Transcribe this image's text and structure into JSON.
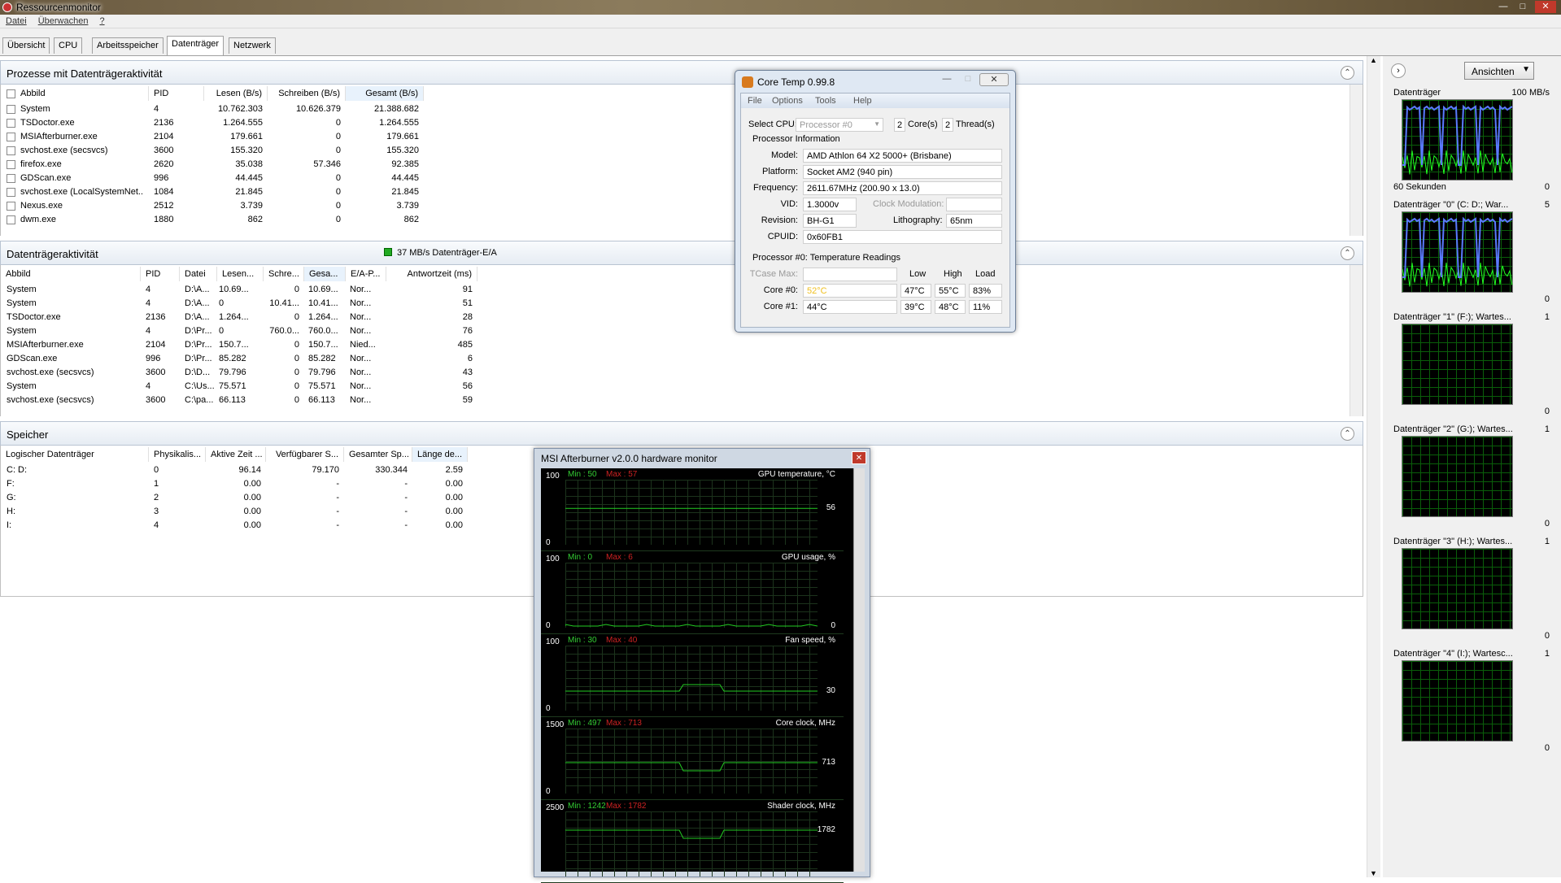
{
  "window": {
    "title": "Ressourcenmonitor"
  },
  "menu": [
    "Datei",
    "Überwachen",
    "?"
  ],
  "tabs": [
    "Übersicht",
    "CPU",
    "Arbeitsspeicher",
    "Datenträger",
    "Netzwerk"
  ],
  "proc": {
    "title": "Prozesse mit Datenträgeraktivität",
    "headers": [
      "Abbild",
      "PID",
      "Lesen (B/s)",
      "Schreiben (B/s)",
      "Gesamt (B/s)"
    ],
    "rows": [
      [
        "System",
        "4",
        "10.762.303",
        "10.626.379",
        "21.388.682"
      ],
      [
        "TSDoctor.exe",
        "2136",
        "1.264.555",
        "0",
        "1.264.555"
      ],
      [
        "MSIAfterburner.exe",
        "2104",
        "179.661",
        "0",
        "179.661"
      ],
      [
        "svchost.exe (secsvcs)",
        "3600",
        "155.320",
        "0",
        "155.320"
      ],
      [
        "firefox.exe",
        "2620",
        "35.038",
        "57.346",
        "92.385"
      ],
      [
        "GDScan.exe",
        "996",
        "44.445",
        "0",
        "44.445"
      ],
      [
        "svchost.exe (LocalSystemNet...",
        "1084",
        "21.845",
        "0",
        "21.845"
      ],
      [
        "Nexus.exe",
        "2512",
        "3.739",
        "0",
        "3.739"
      ],
      [
        "dwm.exe",
        "1880",
        "862",
        "0",
        "862"
      ]
    ]
  },
  "disk": {
    "title": "Datenträgeraktivität",
    "badge": "37 MB/s Datenträger-E/A",
    "headers": [
      "Abbild",
      "PID",
      "Datei",
      "Lesen...",
      "Schre...",
      "Gesa...",
      "E/A-P...",
      "Antwortzeit (ms)"
    ],
    "rows": [
      [
        "System",
        "4",
        "D:\\A...",
        "10.69...",
        "0",
        "10.69...",
        "Nor...",
        "91"
      ],
      [
        "System",
        "4",
        "D:\\A...",
        "0",
        "10.41...",
        "10.41...",
        "Nor...",
        "51"
      ],
      [
        "TSDoctor.exe",
        "2136",
        "D:\\A...",
        "1.264...",
        "0",
        "1.264...",
        "Nor...",
        "28"
      ],
      [
        "System",
        "4",
        "D:\\Pr...",
        "0",
        "760.0...",
        "760.0...",
        "Nor...",
        "76"
      ],
      [
        "MSIAfterburner.exe",
        "2104",
        "D:\\Pr...",
        "150.7...",
        "0",
        "150.7...",
        "Nied...",
        "485"
      ],
      [
        "GDScan.exe",
        "996",
        "D:\\Pr...",
        "85.282",
        "0",
        "85.282",
        "Nor...",
        "6"
      ],
      [
        "svchost.exe (secsvcs)",
        "3600",
        "D:\\D...",
        "79.796",
        "0",
        "79.796",
        "Nor...",
        "43"
      ],
      [
        "System",
        "4",
        "C:\\Us...",
        "75.571",
        "0",
        "75.571",
        "Nor...",
        "56"
      ],
      [
        "svchost.exe (secsvcs)",
        "3600",
        "C:\\pa...",
        "66.113",
        "0",
        "66.113",
        "Nor...",
        "59"
      ]
    ]
  },
  "storage": {
    "title": "Speicher",
    "headers": [
      "Logischer Datenträger",
      "Physikalis...",
      "Aktive Zeit ...",
      "Verfügbarer S...",
      "Gesamter Sp...",
      "Länge de..."
    ],
    "rows": [
      [
        "C: D:",
        "0",
        "96.14",
        "79.170",
        "330.344",
        "2.59"
      ],
      [
        "F:",
        "1",
        "0.00",
        "-",
        "-",
        "0.00"
      ],
      [
        "G:",
        "2",
        "0.00",
        "-",
        "-",
        "0.00"
      ],
      [
        "H:",
        "3",
        "0.00",
        "-",
        "-",
        "0.00"
      ],
      [
        "I:",
        "4",
        "0.00",
        "-",
        "-",
        "0.00"
      ]
    ]
  },
  "right": {
    "views_label": "Ansichten",
    "graphs": [
      {
        "label": "Datenträger",
        "top_value": "100 MB/s",
        "bottom_label": "60 Sekunden",
        "bottom_value": "0"
      },
      {
        "label": "Datenträger \"0\" (C: D:; War...",
        "top_value": "5",
        "bottom_value": "0"
      },
      {
        "label": "Datenträger \"1\" (F:); Wartes...",
        "top_value": "1",
        "bottom_value": "0"
      },
      {
        "label": "Datenträger \"2\" (G:); Wartes...",
        "top_value": "1",
        "bottom_value": "0"
      },
      {
        "label": "Datenträger \"3\" (H:); Wartes...",
        "top_value": "1",
        "bottom_value": "0"
      },
      {
        "label": "Datenträger \"4\" (I:); Wartesc...",
        "top_value": "1",
        "bottom_value": "0"
      }
    ]
  },
  "coretemp": {
    "title": "Core Temp 0.99.8",
    "menu": [
      "File",
      "Options",
      "Tools",
      "Help"
    ],
    "select_cpu_label": "Select CPU:",
    "processor": "Processor #0",
    "cores": "2",
    "cores_label": "Core(s)",
    "threads": "2",
    "threads_label": "Thread(s)",
    "info_title": "Processor Information",
    "model_label": "Model:",
    "model": "AMD Athlon 64 X2 5000+ (Brisbane)",
    "platform_label": "Platform:",
    "platform": "Socket AM2 (940 pin)",
    "freq_label": "Frequency:",
    "freq": "2611.67MHz (200.90 x 13.0)",
    "vid_label": "VID:",
    "vid": "1.3000v",
    "clockmod_label": "Clock Modulation:",
    "rev_label": "Revision:",
    "rev": "BH-G1",
    "litho_label": "Lithography:",
    "litho": "65nm",
    "cpuid_label": "CPUID:",
    "cpuid": "0x60FB1",
    "temp_title": "Processor #0: Temperature Readings",
    "tcase_label": "TCase Max:",
    "low_label": "Low",
    "high_label": "High",
    "load_label": "Load",
    "cores_rows": [
      {
        "label": "Core #0:",
        "temp": "52°C",
        "low": "47°C",
        "high": "55°C",
        "load": "83%"
      },
      {
        "label": "Core #1:",
        "temp": "44°C",
        "low": "39°C",
        "high": "48°C",
        "load": "11%"
      }
    ]
  },
  "msi": {
    "title": "MSI Afterburner v2.0.0 hardware monitor",
    "graphs": [
      {
        "name": "GPU temperature, °C",
        "ymax": "100",
        "ymin": "0",
        "min": "Min : 50",
        "max": "Max : 57",
        "current": "56",
        "level": 0.56
      },
      {
        "name": "GPU usage, %",
        "ymax": "100",
        "ymin": "0",
        "min": "Min : 0",
        "max": "Max : 6",
        "current": "0",
        "level": 0.0
      },
      {
        "name": "Fan speed, %",
        "ymax": "100",
        "ymin": "0",
        "min": "Min : 30",
        "max": "Max : 40",
        "current": "30",
        "level": 0.3
      },
      {
        "name": "Core clock, MHz",
        "ymax": "1500",
        "ymin": "0",
        "min": "Min : 497",
        "max": "Max : 713",
        "current": "713",
        "level": 0.475
      },
      {
        "name": "Shader clock, MHz",
        "ymax": "2500",
        "ymin": "",
        "min": "Min : 1242",
        "max": "Max : 1782",
        "current": "1782",
        "level": 0.713
      }
    ]
  }
}
